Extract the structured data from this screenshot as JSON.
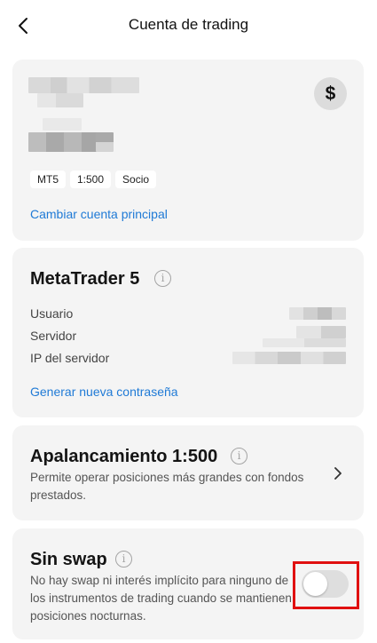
{
  "header": {
    "title": "Cuenta de trading"
  },
  "account": {
    "currency_icon": "dollar-icon",
    "badges": [
      "MT5",
      "1:500",
      "Socio"
    ],
    "change_link": "Cambiar cuenta principal"
  },
  "metatrader": {
    "title": "MetaTrader 5",
    "rows": [
      {
        "label": "Usuario"
      },
      {
        "label": "Servidor"
      },
      {
        "label": "IP del servidor"
      }
    ],
    "password_link": "Generar nueva contraseña"
  },
  "leverage": {
    "title": "Apalancamiento 1:500",
    "description": "Permite operar posiciones más grandes con fondos prestados."
  },
  "swap": {
    "title": "Sin swap",
    "description": "No hay swap ni interés implícito para ninguno de los instrumentos de trading cuando se mantienen posiciones nocturnas.",
    "enabled": false
  },
  "colors": {
    "link": "#1f7ad6",
    "card": "#f4f4f4",
    "highlight": "#e01010"
  }
}
